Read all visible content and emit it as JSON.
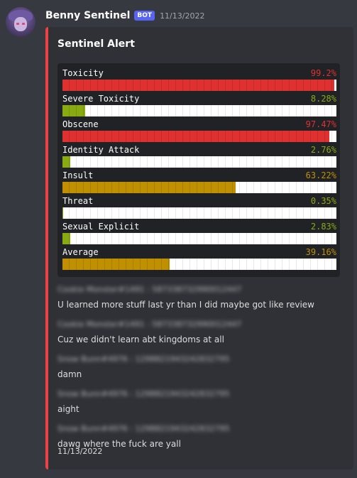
{
  "message": {
    "username": "Benny Sentinel",
    "badge": "BOT",
    "timestamp": "11/13/2022"
  },
  "embed": {
    "title": "Sentinel Alert",
    "accent_color": "#ed4245",
    "scores": [
      {
        "label": "Toxicity",
        "value": "99.2%",
        "fraction": 0.992,
        "color": "#e03131"
      },
      {
        "label": "Severe Toxicity",
        "value": "8.28%",
        "fraction": 0.0828,
        "color": "#8aaa12"
      },
      {
        "label": "Obscene",
        "value": "97.47%",
        "fraction": 0.9747,
        "color": "#e03131"
      },
      {
        "label": "Identity Attack",
        "value": "2.76%",
        "fraction": 0.0276,
        "color": "#8aaa12"
      },
      {
        "label": "Insult",
        "value": "63.22%",
        "fraction": 0.6322,
        "color": "#c09000"
      },
      {
        "label": "Threat",
        "value": "0.35%",
        "fraction": 0.0035,
        "color": "#8aaa12"
      },
      {
        "label": "Sexual Explicit",
        "value": "2.83%",
        "fraction": 0.0283,
        "color": "#8aaa12"
      },
      {
        "label": "Average",
        "value": "39.16%",
        "fraction": 0.3916,
        "color": "#c09000"
      }
    ],
    "messages": [
      {
        "author": "Cookie Monster#1491 : 587338732990012447",
        "text": "U learned more stuff last yr than I did maybe got like review"
      },
      {
        "author": "Cookie Monster#1491 : 587338732990012447",
        "text": "Cuz we didn't learn abt kingdoms at all"
      },
      {
        "author": "Snow Bunn#4976 : 1298821943242832795",
        "text": "damn"
      },
      {
        "author": "Snow Bunn#4976 : 1298821943242832795",
        "text": "aight"
      },
      {
        "author": "Snow Bunn#4976 : 1298821943242832795",
        "text": "dawg where the fuck are yall"
      }
    ],
    "footer": "11/13/2022"
  }
}
